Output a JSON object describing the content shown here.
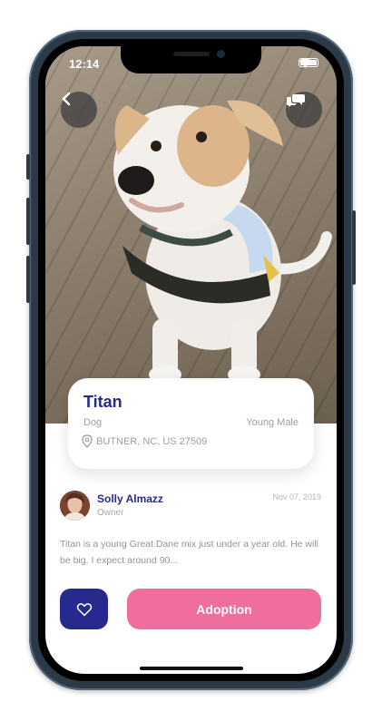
{
  "status_bar": {
    "time": "12:14"
  },
  "icons": {
    "back": "chevron-left-icon",
    "chat": "chat-bubbles-icon",
    "location": "location-pin-icon",
    "favorite": "heart-icon",
    "wifi": "wifi-icon",
    "battery": "battery-icon"
  },
  "pet": {
    "name": "Titan",
    "species": "Dog",
    "traits": "Young Male",
    "location": "BUTNER, NC, US 27509"
  },
  "owner": {
    "name": "Solly Almazz",
    "role": "Owner",
    "date": "Nov 07, 2019"
  },
  "description": "Titan is a young Great Dane mix just under a year old. He will be big. I expect around 90...",
  "actions": {
    "adopt_label": "Adoption"
  },
  "colors": {
    "primary": "#262a8f",
    "accent": "#ef6e9e",
    "muted_text": "#9a9ea8"
  }
}
